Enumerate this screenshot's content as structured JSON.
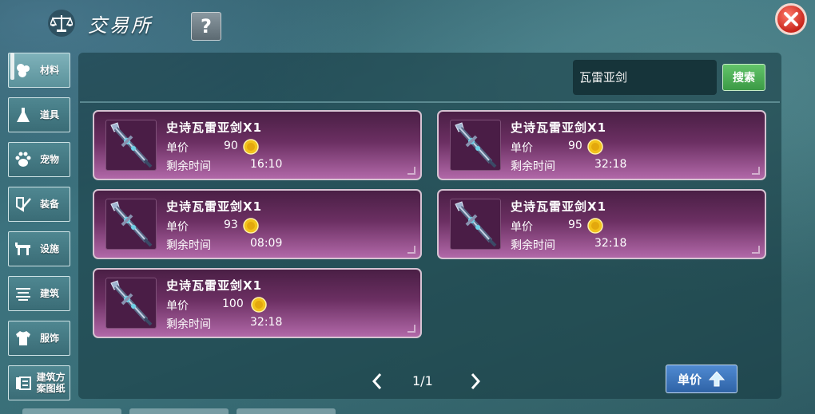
{
  "header": {
    "title": "交易所",
    "help_label": "?"
  },
  "sidebar": {
    "items": [
      {
        "label": "材料",
        "icon": "material-icon"
      },
      {
        "label": "道具",
        "icon": "potion-icon"
      },
      {
        "label": "宠物",
        "icon": "paw-icon"
      },
      {
        "label": "装备",
        "icon": "equipment-icon"
      },
      {
        "label": "设施",
        "icon": "facility-icon"
      },
      {
        "label": "建筑",
        "icon": "building-icon"
      },
      {
        "label": "服饰",
        "icon": "clothing-icon"
      },
      {
        "label": "建筑方案图纸",
        "icon": "blueprint-icon"
      }
    ]
  },
  "search": {
    "value": "瓦雷亚剑",
    "button_label": "搜索"
  },
  "listings": {
    "price_label": "单价",
    "time_label": "剩余时间",
    "items": [
      {
        "name": "史诗瓦雷亚剑X1",
        "price": "90",
        "time": "16:10"
      },
      {
        "name": "史诗瓦雷亚剑X1",
        "price": "90",
        "time": "32:18"
      },
      {
        "name": "史诗瓦雷亚剑X1",
        "price": "93",
        "time": "08:09"
      },
      {
        "name": "史诗瓦雷亚剑X1",
        "price": "95",
        "time": "32:18"
      },
      {
        "name": "史诗瓦雷亚剑X1",
        "price": "100",
        "time": "32:18"
      }
    ]
  },
  "pagination": {
    "text": "1/1"
  },
  "sort": {
    "label": "单价"
  },
  "colors": {
    "card_top": "#4a1f45",
    "card_bottom": "#b168a8",
    "search_green": "#3b9a45",
    "close_red": "#c8261c"
  }
}
